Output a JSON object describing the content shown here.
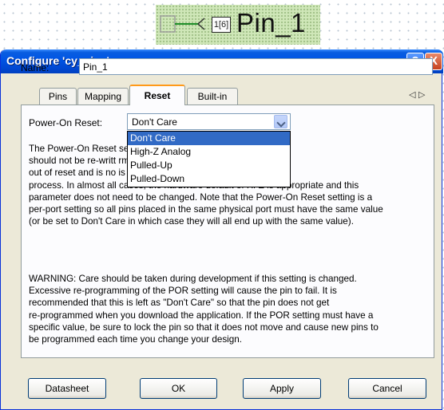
{
  "canvas": {
    "component_index": "1[6]",
    "component_name": "Pin_1"
  },
  "dialog": {
    "title": "Configure 'cy_pins'",
    "help_label": "?",
    "close_label": "X",
    "name_label": "Name:",
    "name_value": "Pin_1",
    "tabs": [
      {
        "label": "Pins"
      },
      {
        "label": "Mapping"
      },
      {
        "label": "Reset",
        "active": true
      },
      {
        "label": "Built-in"
      }
    ],
    "tab_scroll": "◁ ▷",
    "reset": {
      "por_label": "Power-On Reset:",
      "por_value": "Don't Care",
      "options": [
        "Don't Care",
        "High-Z Analog",
        "Pulled-Up",
        "Pulled-Down"
      ],
      "selected_option": "Don't Care",
      "description_lines": [
        "The Power-On Reset                                              semi-permanent attribute that",
        "should not be re-writt                                          rmines how the pin behaves",
        "out of reset and is no                                          is set during the boot",
        "process. In almost all cases, the hardware default of Hi-Z is appropriate and this",
        "parameter does not need to be changed. Note that the Power-On Reset setting is a",
        "per-port setting so all pins placed in the same physical port must have the same value",
        "(or be set to Don't Care in which case they will all end up with the same value)."
      ],
      "warning_lines": [
        "WARNING: Care should be taken during development if this setting is changed.",
        "Excessive re-programming of the POR setting will cause the pin to fail. It is",
        "recommended that this is left as \"Don't Care\" so that the pin does not get",
        "re-programmed when you download the application. If the POR setting must have a",
        "specific value, be sure to lock the pin so that it does not move and cause new pins to",
        "be programmed each time you change your design."
      ]
    },
    "buttons": {
      "datasheet": "Datasheet",
      "ok": "OK",
      "apply": "Apply",
      "cancel": "Cancel"
    }
  },
  "colors": {
    "titlebar": "#0055e5",
    "dialog_bg": "#ece9d8",
    "selection": "#316ac5",
    "active_tab_accent": "#ff9a1a",
    "component_bg": "#cfe7b8"
  },
  "icons": [
    "help-icon",
    "close-icon",
    "dropdown-arrow-icon",
    "tab-scroll-icon",
    "pin-wire-icon"
  ]
}
